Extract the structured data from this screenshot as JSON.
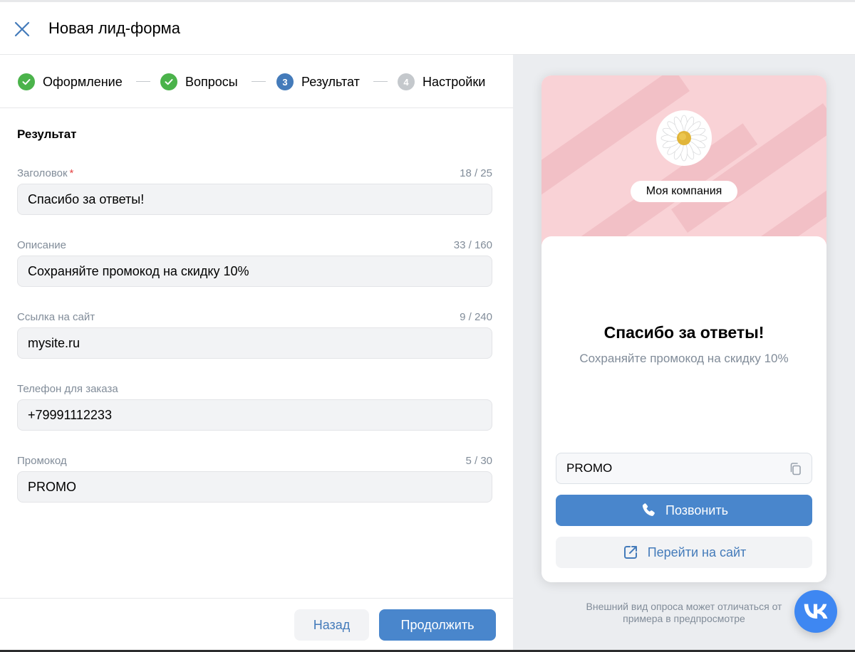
{
  "header": {
    "title": "Новая лид-форма",
    "close_icon": "close-icon"
  },
  "steps": [
    {
      "number": "1",
      "label": "Оформление",
      "state": "done"
    },
    {
      "number": "2",
      "label": "Вопросы",
      "state": "done"
    },
    {
      "number": "3",
      "label": "Результат",
      "state": "active"
    },
    {
      "number": "4",
      "label": "Настройки",
      "state": "pending"
    }
  ],
  "form": {
    "section_title": "Результат",
    "fields": [
      {
        "label": "Заголовок",
        "required_mark": "*",
        "counter": "18 / 25",
        "value": "Спасибо за ответы!"
      },
      {
        "label": "Описание",
        "counter": "33 / 160",
        "value": "Сохраняйте промокод на скидку 10%"
      },
      {
        "label": "Ссылка на сайт",
        "counter": "9 / 240",
        "value": "mysite.ru"
      },
      {
        "label": "Телефон для заказа",
        "counter": "",
        "value": "+79991112233"
      },
      {
        "label": "Промокод",
        "counter": "5 / 30",
        "value": "PROMO"
      }
    ]
  },
  "footer": {
    "back_label": "Назад",
    "continue_label": "Продолжить"
  },
  "preview": {
    "company_name": "Моя компания",
    "title": "Спасибо за ответы!",
    "description": "Сохраняйте промокод на скидку 10%",
    "promo_code": "PROMO",
    "call_label": "Позвонить",
    "site_label": "Перейти на сайт",
    "disclaimer_line1": "Внешний вид опроса может отличаться от",
    "disclaimer_line2": "примера в предпросмотре"
  },
  "colors": {
    "accent": "#4986cc",
    "accent_text": "#447bba",
    "done": "#4bb34b",
    "pending": "#c4c8cc",
    "cover": "#f9d2d6",
    "vk_blue": "#3e87f2"
  },
  "icons": {
    "step_done": "check-circle-icon",
    "copy": "copy-icon",
    "phone": "phone-icon",
    "external_link": "external-link-icon",
    "logo": "daisy-flower-icon",
    "fab": "vk-logo-icon"
  }
}
